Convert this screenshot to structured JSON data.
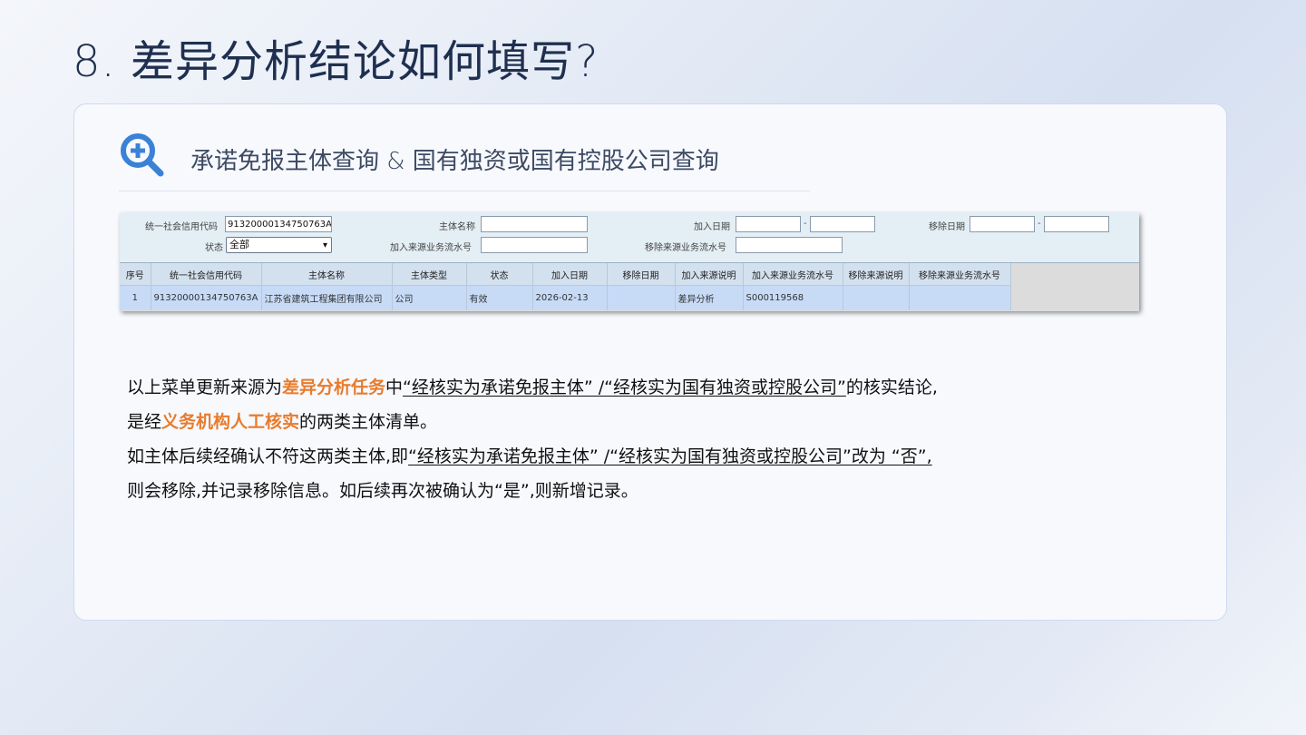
{
  "slide": {
    "title": "8. 差异分析结论如何填写?"
  },
  "section": {
    "heading": "承诺免报主体查询 & 国有独资或国有控股公司查询",
    "icon": "zoom-in-icon"
  },
  "search_form": {
    "credit_code_label": "统一社会信用代码",
    "credit_code_value": "91320000134750763A",
    "entity_name_label": "主体名称",
    "entity_name_value": "",
    "join_date_label": "加入日期",
    "remove_date_label": "移除日期",
    "date_separator": "-",
    "status_label": "状态",
    "status_value": "全部",
    "join_serial_label": "加入来源业务流水号",
    "remove_serial_label": "移除来源业务流水号"
  },
  "table": {
    "columns": [
      "序号",
      "统一社会信用代码",
      "主体名称",
      "主体类型",
      "状态",
      "加入日期",
      "移除日期",
      "加入来源说明",
      "加入来源业务流水号",
      "移除来源说明",
      "移除来源业务流水号"
    ],
    "rows": [
      [
        "1",
        "91320000134750763A",
        "江苏省建筑工程集团有限公司",
        "公司",
        "有效",
        "2026-02-13",
        "",
        "差异分析",
        "S000119568",
        "",
        ""
      ]
    ]
  },
  "notes": {
    "line1_a": "以上菜单更新来源为",
    "line1_b": "差异分析任务",
    "line1_c": "中",
    "line1_d": "“经核实为承诺免报主体” /“经核实为国有独资或控股公司”",
    "line1_e": "的核实结论,",
    "line2_a": "是经",
    "line2_b": "义务机构人工核实",
    "line2_c": "的两类主体清单。",
    "line3_a": "如主体后续经确认不符这两类主体,即",
    "line3_b": "“经核实为承诺免报主体” /“经核实为国有独资或控股公司”改为 “否”,",
    "line4": "则会移除,并记录移除信息。如后续再次被确认为“是”,则新增记录。"
  },
  "colors": {
    "accent_orange": "#e87b2c",
    "icon_blue": "#3b82d6",
    "title": "#1f2f4f"
  }
}
